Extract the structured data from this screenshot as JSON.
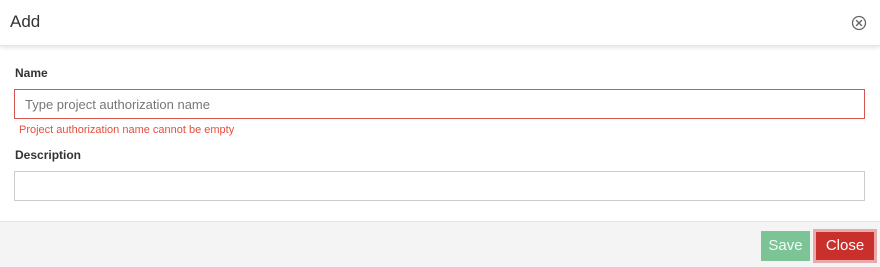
{
  "dialog": {
    "title": "Add"
  },
  "form": {
    "name_label": "Name",
    "name_placeholder": "Type project authorization name",
    "name_value": "",
    "name_error": "Project authorization name cannot be empty",
    "description_label": "Description",
    "description_placeholder": "",
    "description_value": ""
  },
  "footer": {
    "save_label": "Save",
    "close_label": "Close"
  },
  "colors": {
    "error": "#e84c3d",
    "save_button": "#7cc495",
    "close_button": "#c9302c"
  },
  "icons": {
    "dismiss": "close-circle-icon"
  }
}
